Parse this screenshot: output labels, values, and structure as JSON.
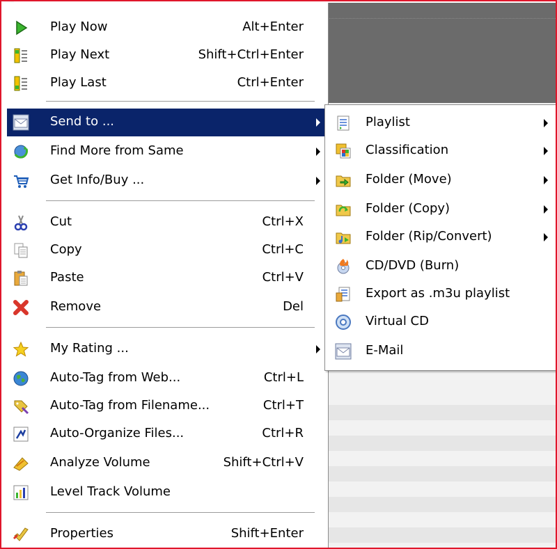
{
  "main_menu": {
    "play_now": {
      "label": "Play Now",
      "shortcut": "Alt+Enter",
      "icon": "play-icon"
    },
    "play_next": {
      "label": "Play Next",
      "shortcut": "Shift+Ctrl+Enter",
      "icon": "queue-next-icon"
    },
    "play_last": {
      "label": "Play Last",
      "shortcut": "Ctrl+Enter",
      "icon": "queue-last-icon"
    },
    "send_to": {
      "label": "Send to ...",
      "icon": "envelope-icon"
    },
    "find_more": {
      "label": "Find More from Same",
      "icon": "find-more-icon"
    },
    "get_info": {
      "label": "Get Info/Buy ...",
      "icon": "cart-icon"
    },
    "cut": {
      "label": "Cut",
      "shortcut": "Ctrl+X",
      "icon": "scissors-icon"
    },
    "copy": {
      "label": "Copy",
      "shortcut": "Ctrl+C",
      "icon": "copy-icon"
    },
    "paste": {
      "label": "Paste",
      "shortcut": "Ctrl+V",
      "icon": "paste-icon"
    },
    "remove": {
      "label": "Remove",
      "shortcut": "Del",
      "icon": "remove-icon"
    },
    "my_rating": {
      "label": "My Rating ...",
      "icon": "star-icon"
    },
    "auto_tag_web": {
      "label": "Auto-Tag from Web...",
      "shortcut": "Ctrl+L",
      "icon": "globe-icon"
    },
    "auto_tag_filename": {
      "label": "Auto-Tag from Filename...",
      "shortcut": "Ctrl+T",
      "icon": "tag-icon"
    },
    "auto_organize": {
      "label": "Auto-Organize Files...",
      "shortcut": "Ctrl+R",
      "icon": "organize-icon"
    },
    "analyze_volume": {
      "label": "Analyze Volume",
      "shortcut": "Shift+Ctrl+V",
      "icon": "analyze-icon"
    },
    "level_volume": {
      "label": "Level Track Volume",
      "icon": "level-icon"
    },
    "properties": {
      "label": "Properties",
      "shortcut": "Shift+Enter",
      "icon": "properties-icon"
    }
  },
  "send_to_submenu": {
    "playlist": {
      "label": "Playlist",
      "icon": "playlist-icon"
    },
    "classification": {
      "label": "Classification",
      "icon": "classification-icon"
    },
    "folder_move": {
      "label": "Folder (Move)",
      "icon": "folder-move-icon"
    },
    "folder_copy": {
      "label": "Folder (Copy)",
      "icon": "folder-copy-icon"
    },
    "folder_rip": {
      "label": "Folder (Rip/Convert)",
      "icon": "folder-rip-icon"
    },
    "cd_burn": {
      "label": "CD/DVD (Burn)",
      "icon": "burn-icon"
    },
    "export_m3u": {
      "label": "Export as .m3u playlist",
      "icon": "export-icon"
    },
    "virtual_cd": {
      "label": "Virtual CD",
      "icon": "cd-icon"
    },
    "email": {
      "label": "E-Mail",
      "icon": "envelope-icon"
    }
  },
  "colors": {
    "highlight": "#0a246a",
    "frame": "#e0162b"
  }
}
